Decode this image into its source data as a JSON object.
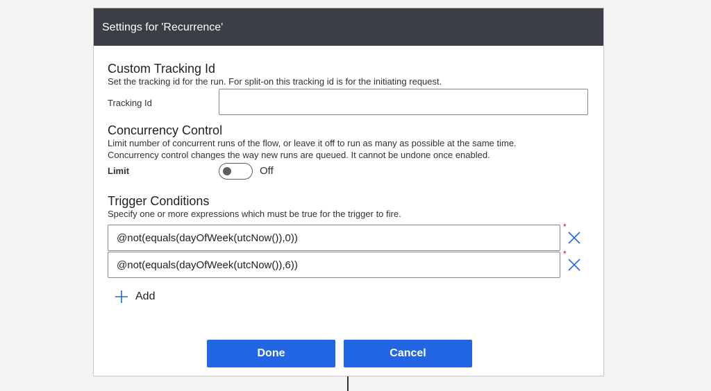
{
  "dialog": {
    "title": "Settings for 'Recurrence'"
  },
  "tracking": {
    "title": "Custom Tracking Id",
    "description": "Set the tracking id for the run. For split-on this tracking id is for the initiating request.",
    "field_label": "Tracking Id",
    "value": ""
  },
  "concurrency": {
    "title": "Concurrency Control",
    "description_line1": "Limit number of concurrent runs of the flow, or leave it off to run as many as possible at the same time.",
    "description_line2": "Concurrency control changes the way new runs are queued. It cannot be undone once enabled.",
    "limit_label": "Limit",
    "toggle_state": "Off"
  },
  "trigger": {
    "title": "Trigger Conditions",
    "description": "Specify one or more expressions which must be true for the trigger to fire.",
    "conditions": [
      {
        "value": "@not(equals(dayOfWeek(utcNow()),0))"
      },
      {
        "value": "@not(equals(dayOfWeek(utcNow()),6))"
      }
    ],
    "required_mark": "*",
    "add_label": "Add"
  },
  "buttons": {
    "done": "Done",
    "cancel": "Cancel"
  },
  "colors": {
    "header_bg": "#3b3f45",
    "primary": "#2266e3",
    "icon_blue": "#2266e3",
    "required": "#a4262c"
  }
}
